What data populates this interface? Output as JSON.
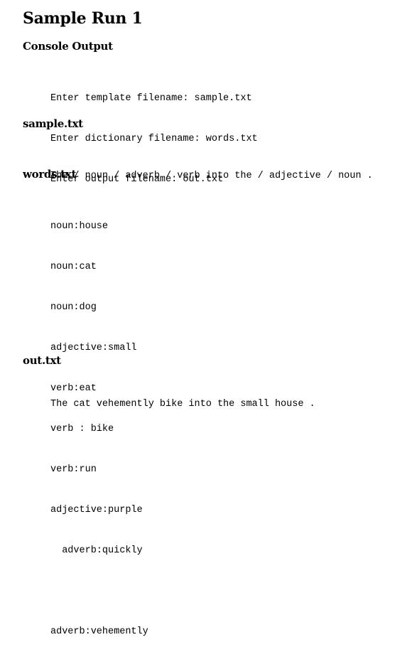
{
  "title": "Sample Run 1",
  "sections": {
    "console": {
      "heading": "Console Output",
      "lines": [
        "Enter template filename: sample.txt",
        "Enter dictionary filename: words.txt",
        "Enter output filename: out.txt"
      ]
    },
    "sample": {
      "heading": "sample.txt",
      "lines": [
        "The / noun / adverb / verb into the / adjective / noun ."
      ]
    },
    "words": {
      "heading": "words.txt",
      "lines": [
        "noun:house",
        "noun:cat",
        "noun:dog",
        "adjective:small",
        "verb:eat",
        "verb : bike",
        "verb:run",
        "adjective:purple",
        "  adverb:quickly",
        "",
        "adverb:vehemently"
      ]
    },
    "out": {
      "heading": "out.txt",
      "lines": [
        "The cat vehemently bike into the small house ."
      ]
    }
  }
}
